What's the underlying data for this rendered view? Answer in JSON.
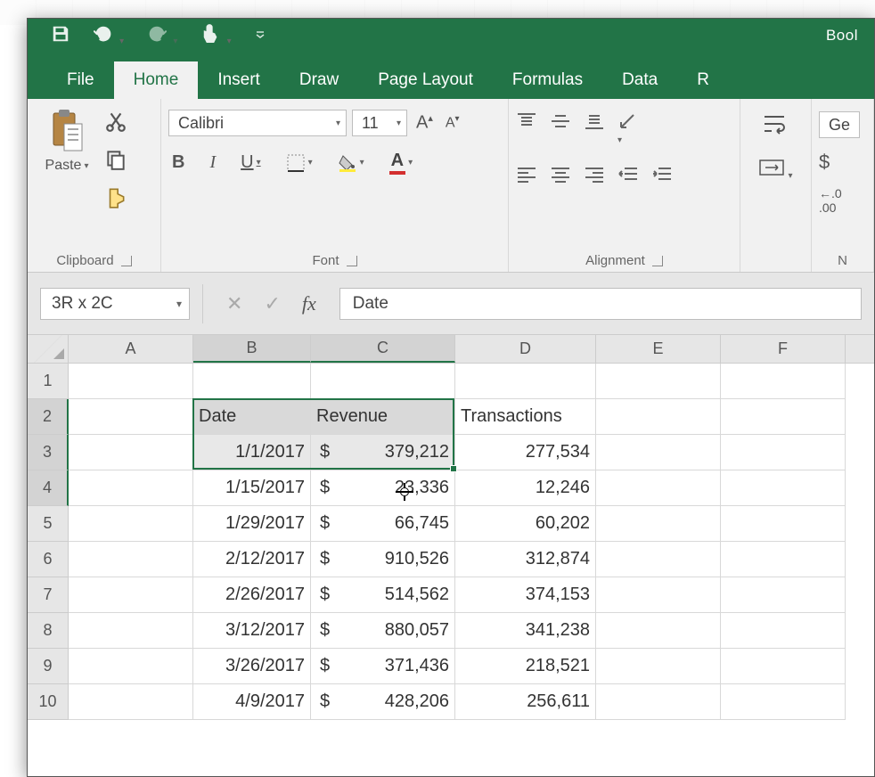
{
  "titlebar": {
    "doc_name": "Bool"
  },
  "tabs": {
    "file": "File",
    "home": "Home",
    "insert": "Insert",
    "draw": "Draw",
    "page_layout": "Page Layout",
    "formulas": "Formulas",
    "data": "Data",
    "review": "R"
  },
  "ribbon": {
    "clipboard": {
      "label": "Clipboard",
      "paste": "Paste"
    },
    "font": {
      "label": "Font",
      "name": "Calibri",
      "size": "11",
      "bold": "B",
      "italic": "I",
      "underline": "U"
    },
    "alignment": {
      "label": "Alignment"
    },
    "number": {
      "label": "N",
      "format": "Ge",
      "currency": "$",
      "decimals": ".00"
    }
  },
  "formula_bar": {
    "namebox": "3R x 2C",
    "fx_label": "fx",
    "content": "Date"
  },
  "columns": [
    {
      "id": "A",
      "w": 140
    },
    {
      "id": "B",
      "w": 132
    },
    {
      "id": "C",
      "w": 162
    },
    {
      "id": "D",
      "w": 158
    },
    {
      "id": "E",
      "w": 140
    },
    {
      "id": "F",
      "w": 140
    }
  ],
  "header_row": {
    "b": "Date",
    "c": "Revenue",
    "d": "Transactions"
  },
  "data_rows": [
    {
      "r": "1"
    },
    {
      "r": "2",
      "header": true
    },
    {
      "r": "3",
      "date": "1/1/2017",
      "rev": "379,212",
      "trans": "277,534",
      "sel": true
    },
    {
      "r": "4",
      "date": "1/15/2017",
      "rev": "23,336",
      "trans": "12,246"
    },
    {
      "r": "5",
      "date": "1/29/2017",
      "rev": "66,745",
      "trans": "60,202"
    },
    {
      "r": "6",
      "date": "2/12/2017",
      "rev": "910,526",
      "trans": "312,874"
    },
    {
      "r": "7",
      "date": "2/26/2017",
      "rev": "514,562",
      "trans": "374,153"
    },
    {
      "r": "8",
      "date": "3/12/2017",
      "rev": "880,057",
      "trans": "341,238"
    },
    {
      "r": "9",
      "date": "3/26/2017",
      "rev": "371,436",
      "trans": "218,521"
    },
    {
      "r": "10",
      "date": "4/9/2017",
      "rev": "428,206",
      "trans": "256,611"
    }
  ],
  "currency_symbol": "$"
}
